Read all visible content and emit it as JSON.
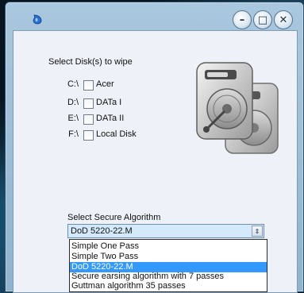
{
  "window": {
    "title": ""
  },
  "disks": {
    "heading": "Select Disk(s) to wipe",
    "items": [
      {
        "letter": "C:\\",
        "name": "Acer",
        "checked": false
      },
      {
        "letter": "D:\\",
        "name": "DATa I",
        "checked": false
      },
      {
        "letter": "E:\\",
        "name": "DATa II",
        "checked": false
      },
      {
        "letter": "F:\\",
        "name": "Local Disk",
        "checked": false
      }
    ]
  },
  "algorithm": {
    "label": "Select Secure Algorithm",
    "selected": "DoD 5220-22.M",
    "options": [
      "Simple One Pass",
      "Simple Two Pass",
      "DoD 5220-22.M",
      "Secure earsing algorithm with 7 passes",
      "Guttman algorithm 35 passes"
    ],
    "highlighted_index": 2
  },
  "icons": {
    "app": "drop-icon",
    "art": "hard-drive-icon",
    "minimize": "minimize-icon",
    "maximize": "maximize-icon",
    "close": "close-icon"
  },
  "colors": {
    "accent": "#3399ff",
    "combo_bg": "#d4e9fb",
    "window_frame": "#a9c8df"
  }
}
